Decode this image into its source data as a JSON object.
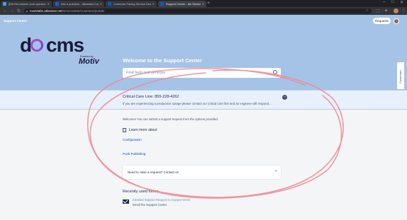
{
  "browser": {
    "tabs": [
      {
        "label": "[Did this answer your question?]",
        "color": "#4c9aff"
      },
      {
        "label": "Ask a question - Atlassian Comm",
        "color": "#1d5bd6"
      },
      {
        "label": "Customer Facing Service Desk",
        "color": "#0a58d0"
      },
      {
        "label": "Support Center - Ike Service Me",
        "color": "#0a58d0"
      }
    ],
    "url_host": "motivlabs.atlassian.net",
    "url_path": "/servicedesk/customer/portals"
  },
  "header": {
    "portal_name": "Support Center",
    "requests_label": "Requests"
  },
  "logo": {
    "d": "d",
    "cms": "cms",
    "powered_by": "Powered by",
    "motiv": "Motiv"
  },
  "hero": {
    "welcome": "Welcome to the Support Center",
    "search_placeholder": "Find help and services"
  },
  "customize_label": "Customize",
  "critical": {
    "title": "Critical Care Line: 855-228-4262",
    "message": "If you are experiencing a production outage please contact our critical care line and an engineer will respond....",
    "toggle": "−"
  },
  "main": {
    "intro": "Welcome! You can submit a support request from the options provided.",
    "learn_more": "Learn more about",
    "links": [
      "Configuration",
      "Push Publishing"
    ],
    "raise_request": "Need to raise a request? Contact us",
    "recent_heading": "Recently used forms",
    "recent_form_title": "Emailed Support Request to Support Desk",
    "recent_form_desc": "Email the Support Center"
  },
  "colors": {
    "banner": "#a5c3e6",
    "link": "#0052cc",
    "scribble": "#ee8c95"
  }
}
